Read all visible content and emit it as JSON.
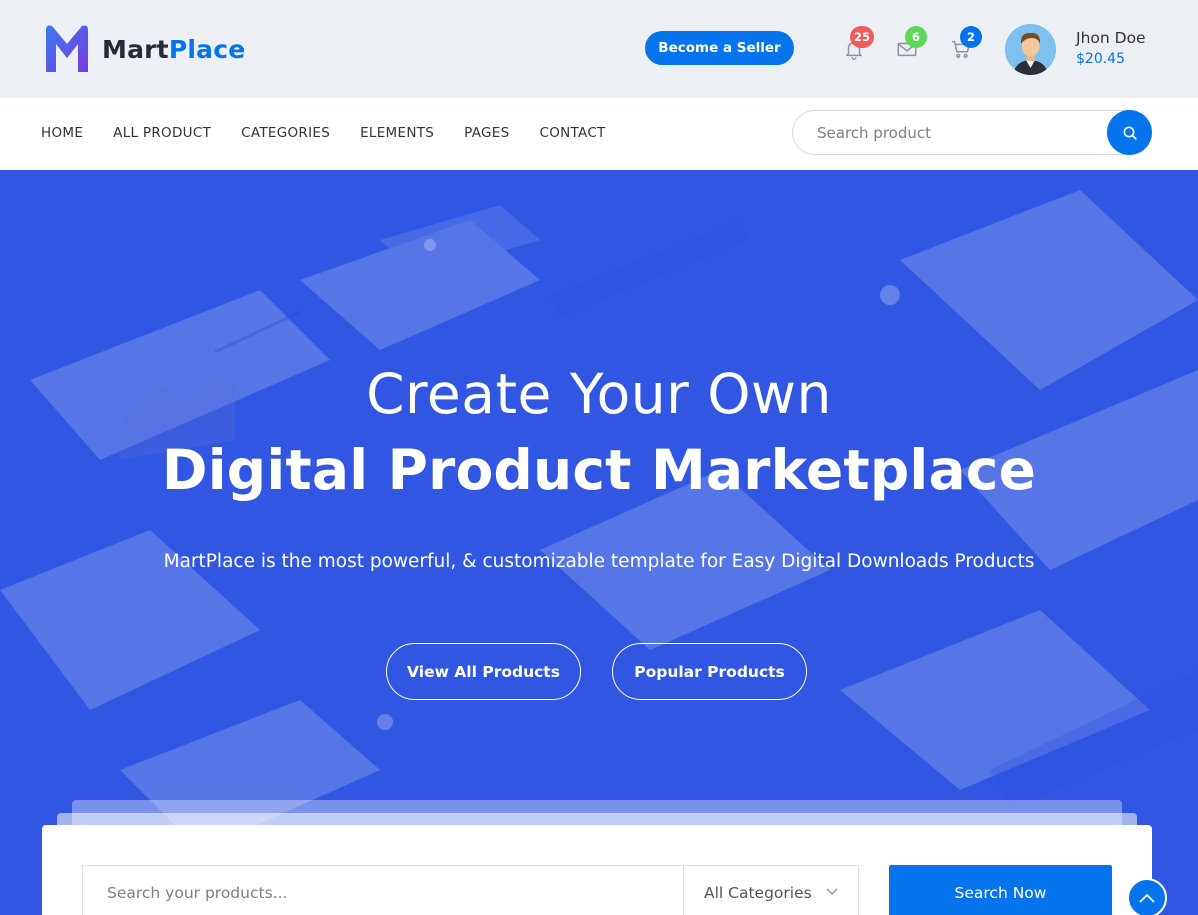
{
  "header": {
    "logo": {
      "part1": "Mart",
      "part2": "Place"
    },
    "become_seller": "Become a Seller",
    "notifications": {
      "icon": "bell-icon",
      "count": "25",
      "color": "#f05b5b"
    },
    "messages": {
      "icon": "envelope-icon",
      "count": "6",
      "color": "#5dd65a"
    },
    "cart": {
      "icon": "cart-icon",
      "count": "2",
      "color": "#0674ec"
    },
    "user": {
      "name": "Jhon Doe",
      "balance": "$20.45"
    }
  },
  "nav": {
    "items": [
      "HOME",
      "ALL PRODUCT",
      "CATEGORIES",
      "ELEMENTS",
      "PAGES",
      "CONTACT"
    ],
    "search_placeholder": "Search product"
  },
  "hero": {
    "title_line1": "Create Your Own",
    "title_line2": "Digital Product Marketplace",
    "subtitle": "MartPlace is the most powerful, & customizable template for Easy Digital Downloads Products",
    "button_all": "View All Products",
    "button_popular": "Popular Products"
  },
  "search_panel": {
    "placeholder": "Search your products...",
    "category": "All Categories",
    "button": "Search Now"
  },
  "colors": {
    "primary": "#0674ec",
    "hero_bg": "#3157e2"
  }
}
